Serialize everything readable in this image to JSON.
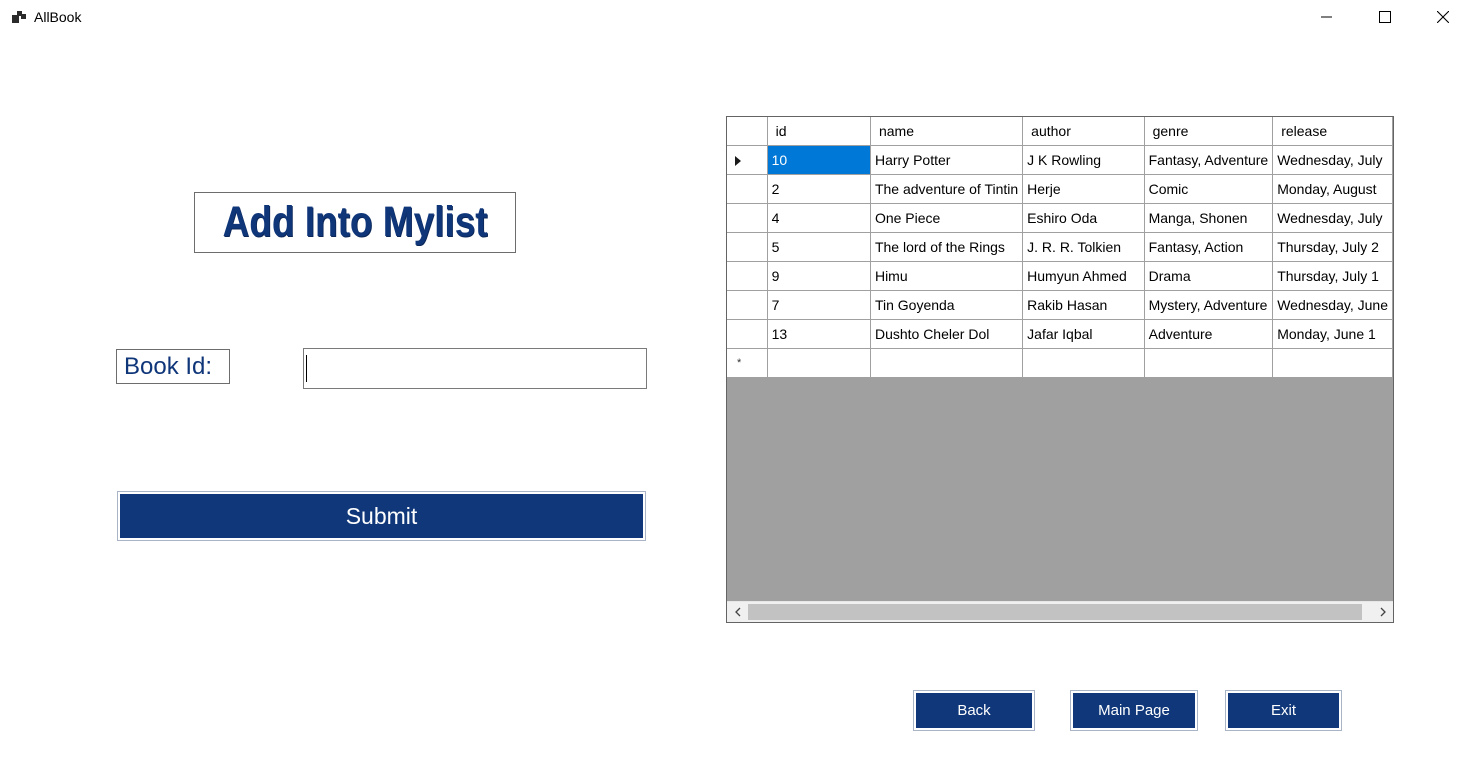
{
  "window": {
    "title": "AllBook",
    "icon": "app-window-icon",
    "controls": {
      "minimize": "minimize-icon",
      "maximize": "maximize-icon",
      "close": "close-icon"
    }
  },
  "form": {
    "heading": "Add Into Mylist",
    "book_id_label": "Book Id:",
    "book_id_value": "",
    "submit_label": "Submit"
  },
  "grid": {
    "columns": [
      "id",
      "name",
      "author",
      "genre",
      "release"
    ],
    "rows": [
      [
        "10",
        "Harry Potter",
        "J K Rowling",
        "Fantasy, Adventure",
        "Wednesday, July"
      ],
      [
        "2",
        "The adventure of Tintin",
        "Herje",
        "Comic",
        "Monday, August"
      ],
      [
        "4",
        "One Piece",
        "Eshiro Oda",
        "Manga, Shonen",
        "Wednesday, July"
      ],
      [
        "5",
        "The lord of the Rings",
        "J. R. R. Tolkien",
        "Fantasy, Action",
        "Thursday, July 2"
      ],
      [
        "9",
        "Himu",
        "Humyun Ahmed",
        "Drama",
        "Thursday, July 1"
      ],
      [
        "7",
        "Tin Goyenda",
        "Rakib Hasan",
        "Mystery, Adventure",
        "Wednesday, June"
      ],
      [
        "13",
        "Dushto Cheler Dol",
        "Jafar Iqbal",
        "Adventure",
        "Monday, June 1"
      ]
    ],
    "current_row": 0,
    "new_row_marker": "*",
    "selection_color": "#0078d7"
  },
  "buttons": {
    "back": "Back",
    "main_page": "Main Page",
    "exit": "Exit"
  },
  "colors": {
    "accent": "#0f3779",
    "label_text": "#10367a",
    "grid_background": "#a0a0a0"
  }
}
